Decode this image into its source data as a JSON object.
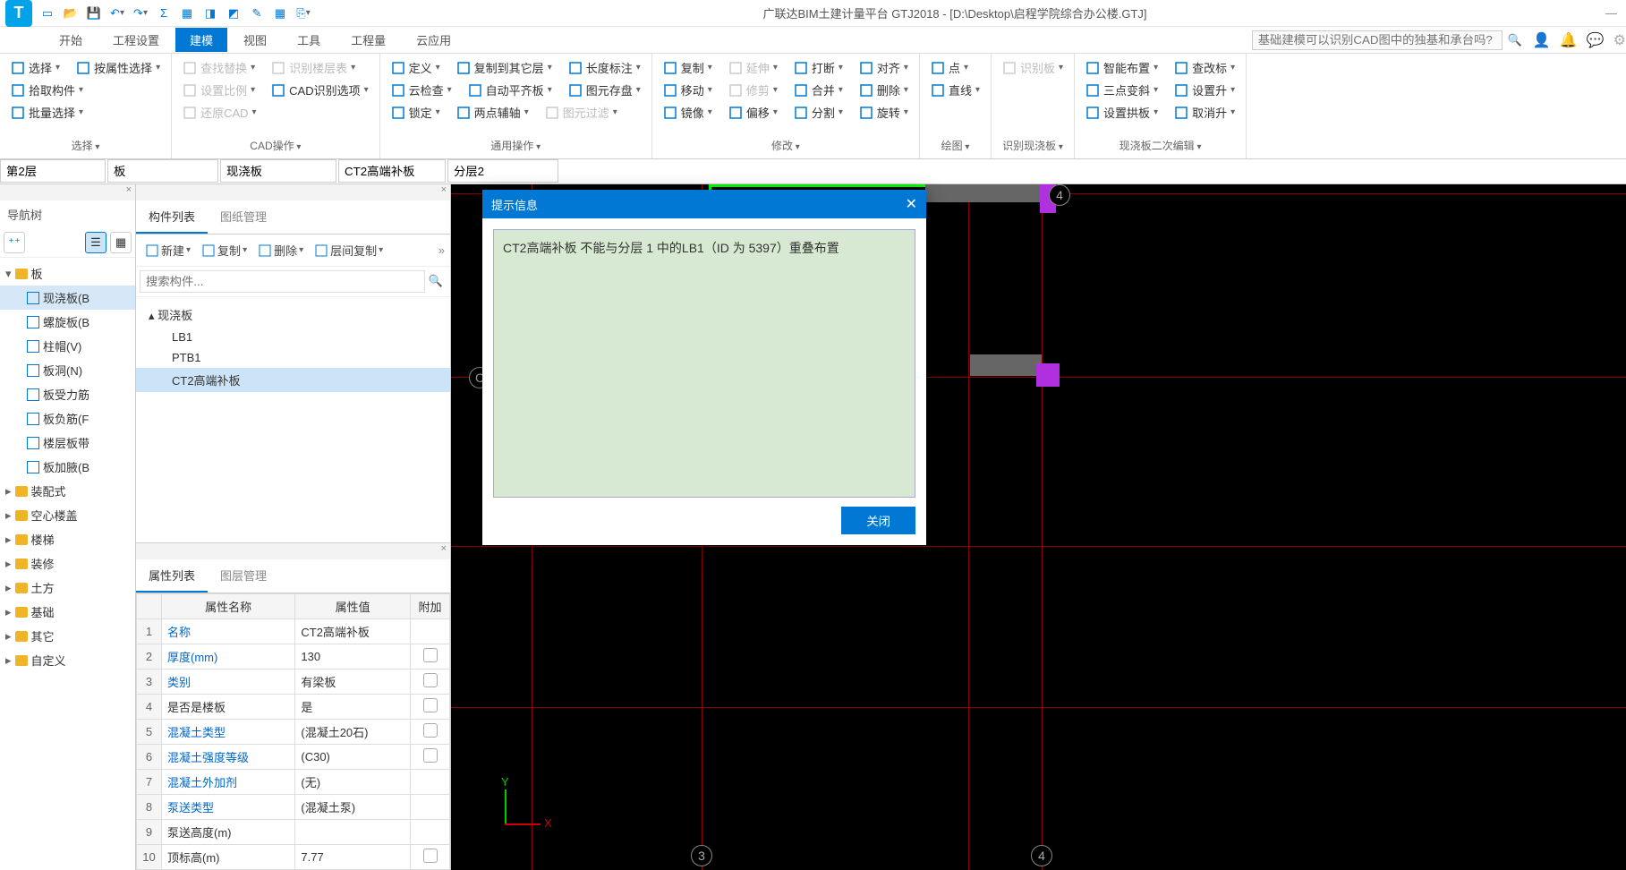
{
  "titlebar": {
    "app_title": "广联达BIM土建计量平台 GTJ2018 - [D:\\Desktop\\启程学院综合办公楼.GTJ]"
  },
  "maintabs": {
    "items": [
      "开始",
      "工程设置",
      "建模",
      "视图",
      "工具",
      "工程量",
      "云应用"
    ],
    "active_index": 2,
    "search_placeholder": "基础建模可以识别CAD图中的独基和承台吗?"
  },
  "ribbon": {
    "groups": [
      {
        "label": "选择",
        "buttons": [
          [
            "选择",
            "按属性选择"
          ],
          [
            "拾取构件",
            ""
          ],
          [
            "批量选择",
            ""
          ]
        ]
      },
      {
        "label": "CAD操作",
        "buttons": [
          [
            "查找替换",
            "识别楼层表"
          ],
          [
            "设置比例",
            "CAD识别选项"
          ],
          [
            "还原CAD",
            ""
          ]
        ]
      },
      {
        "label": "通用操作",
        "buttons": [
          [
            "定义",
            "复制到其它层",
            "长度标注"
          ],
          [
            "云检查",
            "自动平齐板",
            "图元存盘"
          ],
          [
            "锁定",
            "两点辅轴",
            "图元过滤"
          ]
        ]
      },
      {
        "label": "修改",
        "buttons": [
          [
            "复制",
            "延伸",
            "打断",
            "对齐"
          ],
          [
            "移动",
            "修剪",
            "合并",
            "删除"
          ],
          [
            "镜像",
            "偏移",
            "分割",
            "旋转"
          ]
        ]
      },
      {
        "label": "绘图",
        "buttons": [
          [
            "点",
            ""
          ],
          [
            "直线",
            ""
          ],
          [
            "",
            ""
          ]
        ]
      },
      {
        "label": "识别现浇板",
        "buttons": [
          [
            "识别板"
          ]
        ]
      },
      {
        "label": "现浇板二次编辑",
        "buttons": [
          [
            "智能布置",
            "查改标"
          ],
          [
            "三点变斜",
            "设置升"
          ],
          [
            "设置拱板",
            "取消升"
          ]
        ]
      }
    ]
  },
  "selectors": {
    "floor": "第2层",
    "category": "板",
    "type": "现浇板",
    "component": "CT2高端补板",
    "layer": "分层2"
  },
  "navtree": {
    "title": "导航树",
    "root": "板",
    "items": [
      {
        "label": "现浇板(B",
        "selected": true
      },
      {
        "label": "螺旋板(B"
      },
      {
        "label": "柱帽(V)"
      },
      {
        "label": "板洞(N)"
      },
      {
        "label": "板受力筋"
      },
      {
        "label": "板负筋(F"
      },
      {
        "label": "楼层板带"
      },
      {
        "label": "板加腋(B"
      }
    ],
    "cats": [
      "装配式",
      "空心楼盖",
      "楼梯",
      "装修",
      "土方",
      "基础",
      "其它",
      "自定义"
    ]
  },
  "complist": {
    "tabs": [
      "构件列表",
      "图纸管理"
    ],
    "active_tab": 0,
    "toolbar": [
      "新建",
      "复制",
      "删除",
      "层间复制"
    ],
    "search_placeholder": "搜索构件...",
    "root": "现浇板",
    "items": [
      "LB1",
      "PTB1",
      "CT2高端补板"
    ],
    "selected_index": 2
  },
  "props": {
    "tabs": [
      "属性列表",
      "图层管理"
    ],
    "active_tab": 0,
    "headers": [
      "属性名称",
      "属性值",
      "附加"
    ],
    "rows": [
      {
        "n": "1",
        "name": "名称",
        "link": true,
        "value": "CT2高端补板",
        "chk": false
      },
      {
        "n": "2",
        "name": "厚度(mm)",
        "link": true,
        "value": "130",
        "chk": true
      },
      {
        "n": "3",
        "name": "类别",
        "link": true,
        "value": "有梁板",
        "chk": true
      },
      {
        "n": "4",
        "name": "是否是楼板",
        "link": false,
        "value": "是",
        "chk": true
      },
      {
        "n": "5",
        "name": "混凝土类型",
        "link": true,
        "value": "(混凝土20石)",
        "chk": true
      },
      {
        "n": "6",
        "name": "混凝土强度等级",
        "link": true,
        "value": "(C30)",
        "chk": true
      },
      {
        "n": "7",
        "name": "混凝土外加剂",
        "link": true,
        "value": "(无)",
        "chk": false
      },
      {
        "n": "8",
        "name": "泵送类型",
        "link": true,
        "value": "(混凝土泵)",
        "chk": false
      },
      {
        "n": "9",
        "name": "泵送高度(m)",
        "link": false,
        "value": "",
        "chk": false
      },
      {
        "n": "10",
        "name": "顶标高(m)",
        "link": false,
        "value": "7.77",
        "chk": true
      }
    ]
  },
  "dialog": {
    "title": "提示信息",
    "message": "CT2高端补板 不能与分层 1 中的LB1（ID 为 5397）重叠布置",
    "close_btn": "关闭"
  },
  "bubbles": [
    "C",
    "3",
    "4",
    "4"
  ],
  "axis": {
    "x": "X",
    "y": "Y"
  }
}
